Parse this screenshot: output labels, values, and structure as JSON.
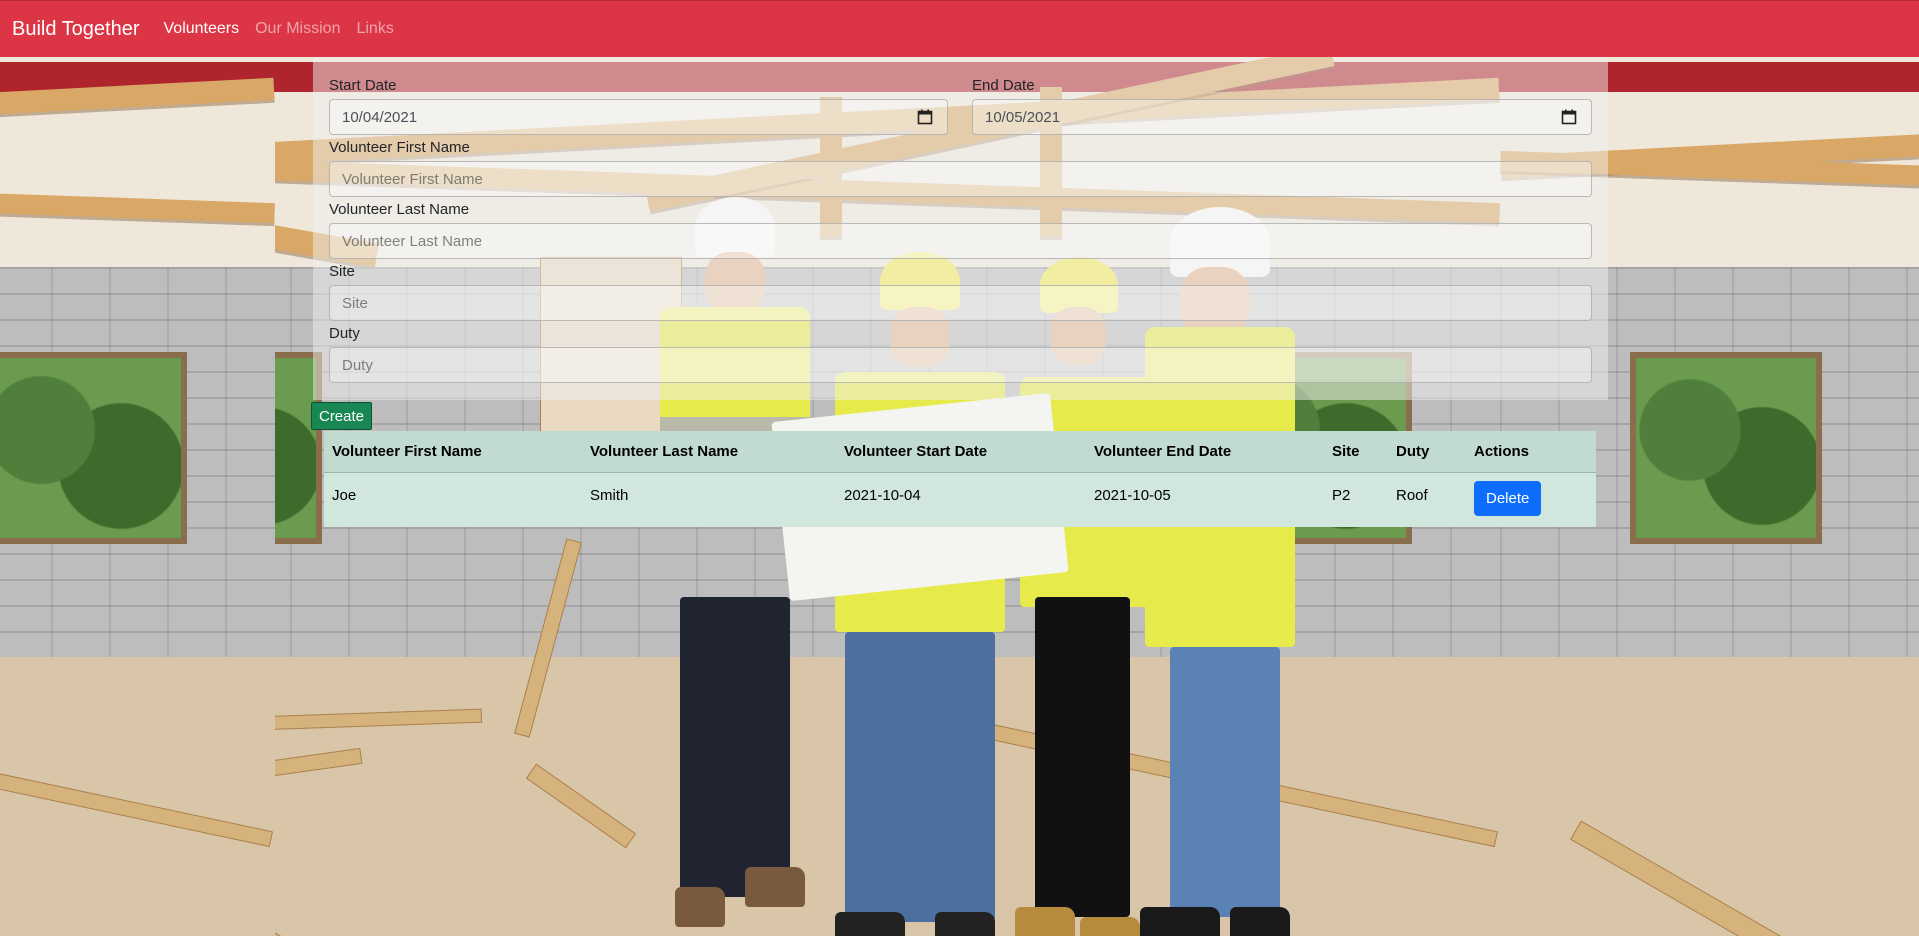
{
  "navbar": {
    "brand": "Build Together",
    "links": [
      "Volunteers",
      "Our Mission",
      "Links"
    ],
    "active_link": "Volunteers"
  },
  "form": {
    "start_date": {
      "label": "Start Date",
      "value": "10/04/2021",
      "icon": "calendar-icon"
    },
    "end_date": {
      "label": "End Date",
      "value": "10/05/2021",
      "icon": "calendar-icon"
    },
    "first_name": {
      "label": "Volunteer First Name",
      "placeholder": "Volunteer First Name"
    },
    "last_name": {
      "label": "Volunteer Last Name",
      "placeholder": "Volunteer Last Name"
    },
    "site": {
      "label": "Site",
      "placeholder": "Site"
    },
    "duty": {
      "label": "Duty",
      "placeholder": "Duty"
    },
    "create_label": "Create"
  },
  "table": {
    "headers": [
      "Volunteer First Name",
      "Volunteer Last Name",
      "Volunteer Start Date",
      "Volunteer End Date",
      "Site",
      "Duty",
      "Actions"
    ],
    "rows": [
      {
        "first": "Joe",
        "last": "Smith",
        "start": "2021-10-04",
        "end": "2021-10-05",
        "site": "P2",
        "duty": "Roof",
        "action": "Delete"
      }
    ]
  },
  "colors": {
    "navbar": "#dc3545",
    "create_button": "#198754",
    "delete_button": "#0d6efd",
    "table_row": "#d1e7dd"
  }
}
